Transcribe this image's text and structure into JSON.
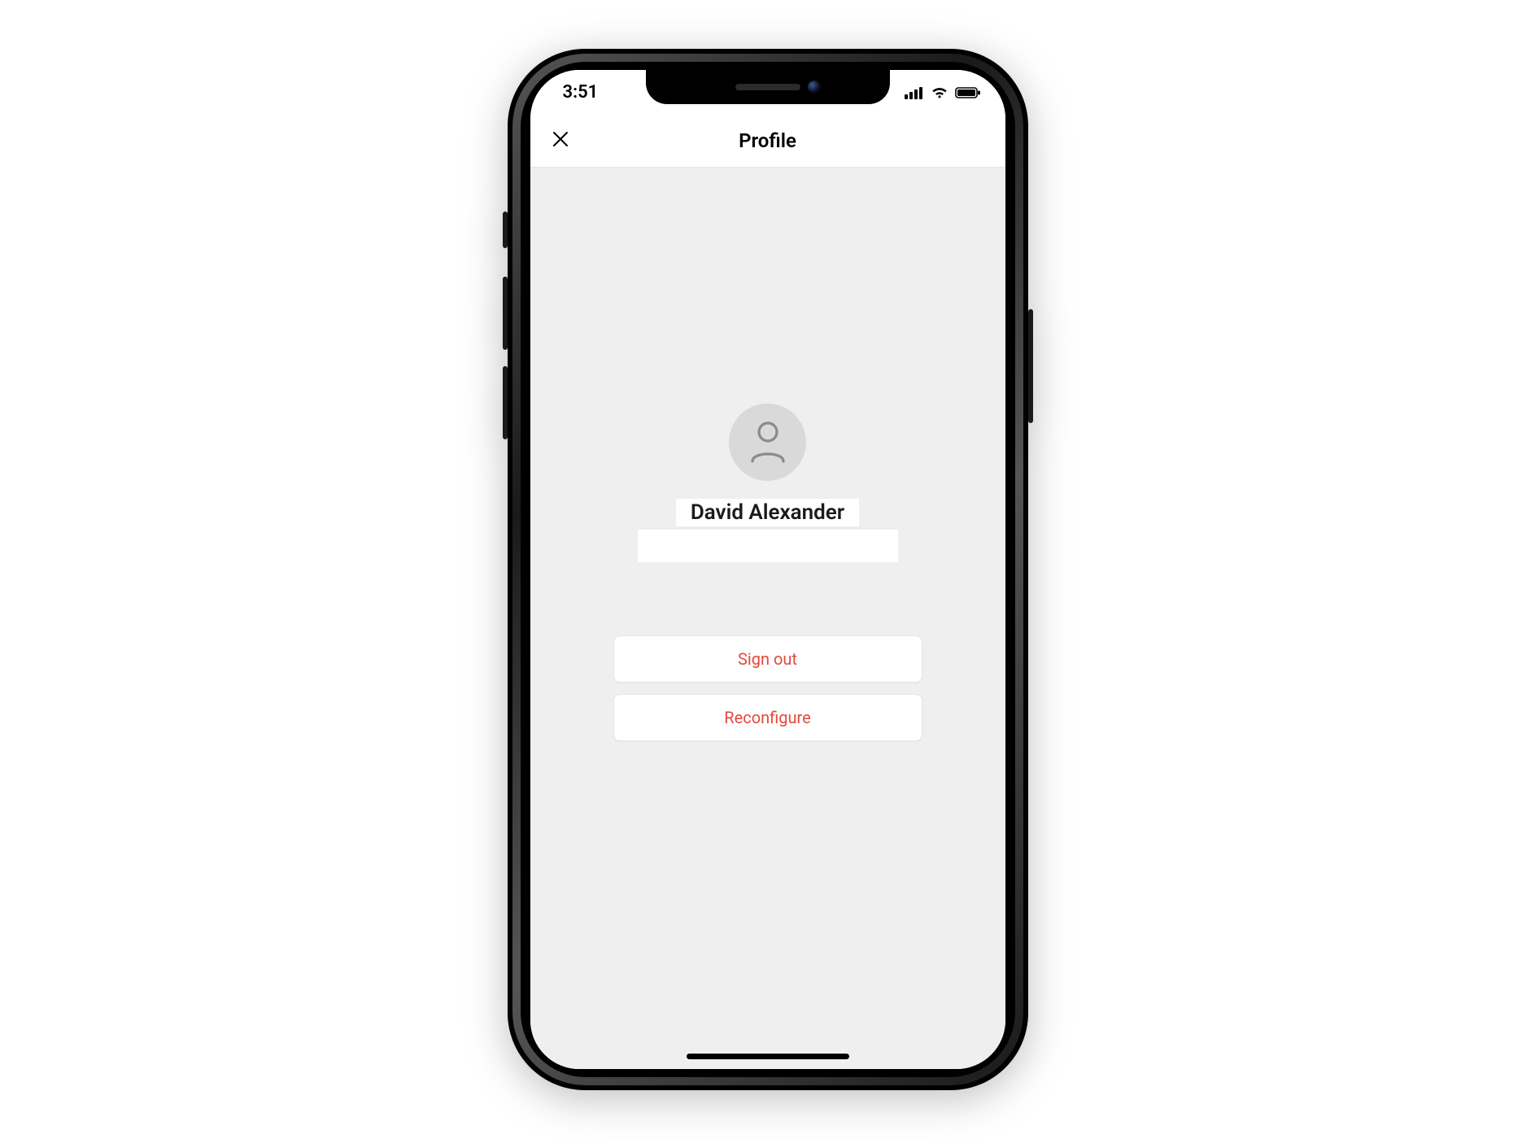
{
  "status_bar": {
    "time": "3:51"
  },
  "nav": {
    "title": "Profile"
  },
  "profile": {
    "name": "David Alexander"
  },
  "actions": {
    "sign_out": "Sign out",
    "reconfigure": "Reconfigure"
  },
  "colors": {
    "danger": "#e24a3b",
    "screen_bg": "#efefef"
  }
}
